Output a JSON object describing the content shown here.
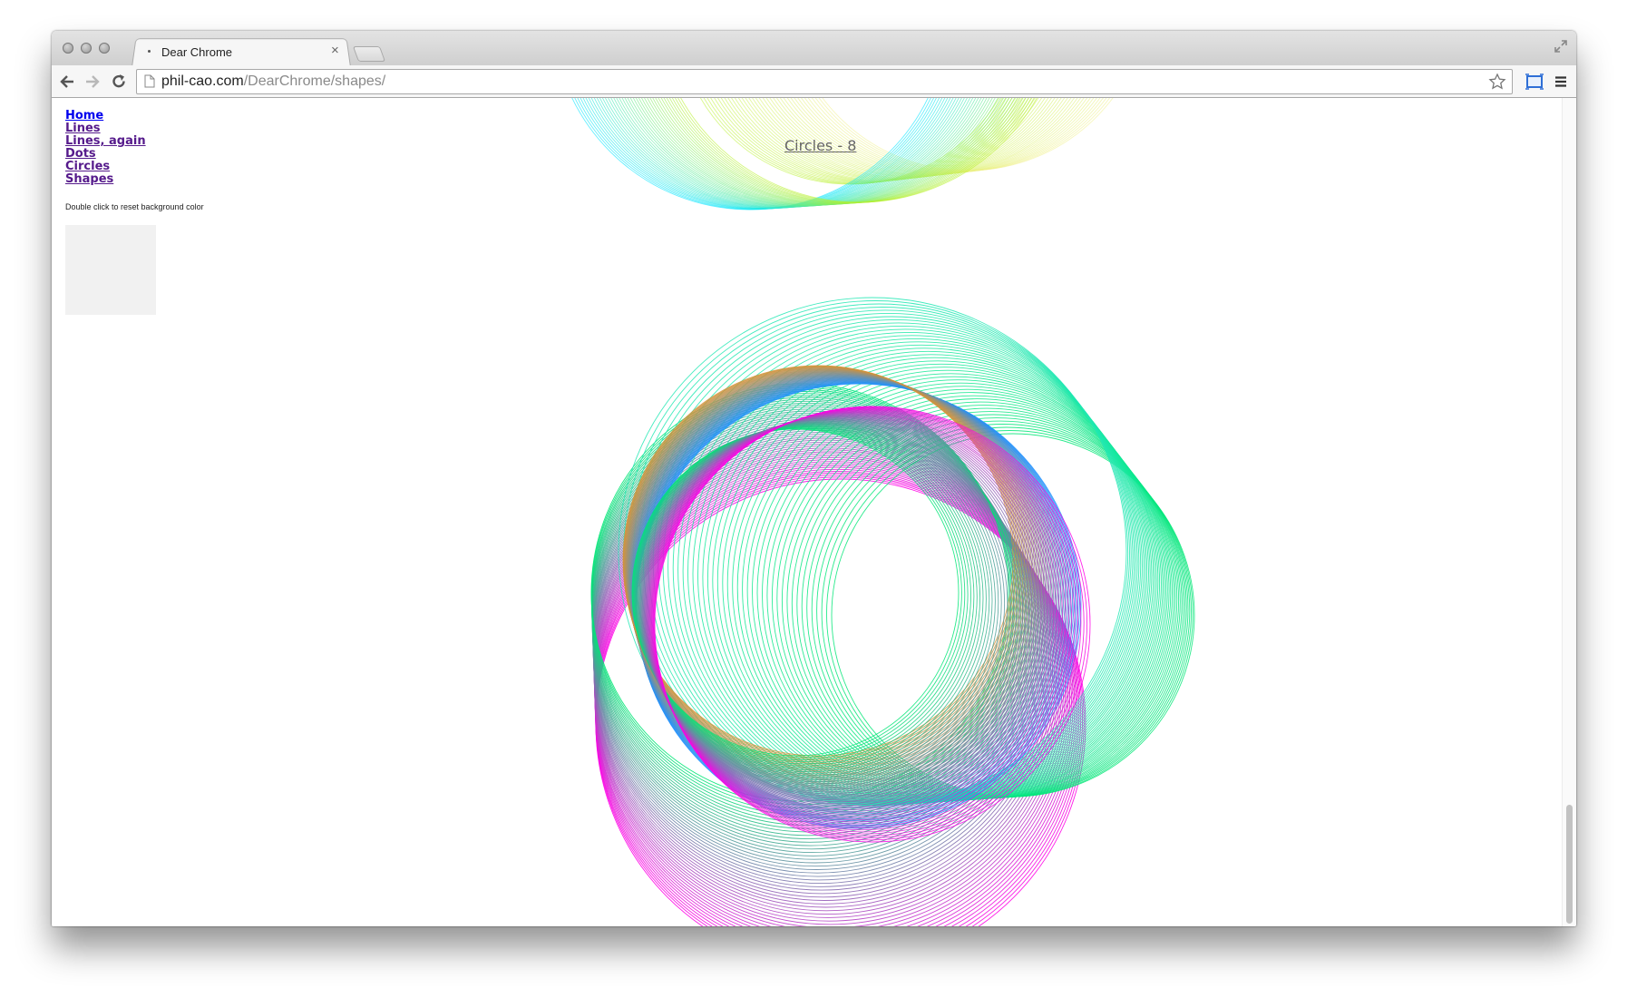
{
  "browser": {
    "tab_title": "Dear Chrome",
    "url_host": "phil-cao.com",
    "url_path": "/DearChrome/shapes/"
  },
  "sidebar": {
    "links": [
      {
        "label": "Home",
        "state": "unvisited"
      },
      {
        "label": "Lines",
        "state": "visited"
      },
      {
        "label": "Lines, again",
        "state": "visited"
      },
      {
        "label": "Dots",
        "state": "visited"
      },
      {
        "label": "Circles",
        "state": "visited"
      },
      {
        "label": "Shapes",
        "state": "visited"
      }
    ],
    "hint": "Double click to reset background color",
    "swatch_color": "#f1f1f1"
  },
  "canvas": {
    "section_title": "Circles - 8",
    "colors": {
      "magenta": "#ff00e6",
      "green": "#00e676",
      "blue": "#1e90ff",
      "orange": "#d4933a",
      "teal": "#22e8b4",
      "cyan": "#00e5ff",
      "lime": "#b8f02a",
      "yellow": "#f0f08a"
    }
  },
  "icons": {
    "back": "arrow-left-icon",
    "forward": "arrow-right-icon",
    "reload": "reload-icon",
    "page": "page-icon",
    "star": "star-icon",
    "cast": "cast-icon",
    "menu": "hamburger-menu-icon",
    "fullscreen": "fullscreen-icon"
  }
}
